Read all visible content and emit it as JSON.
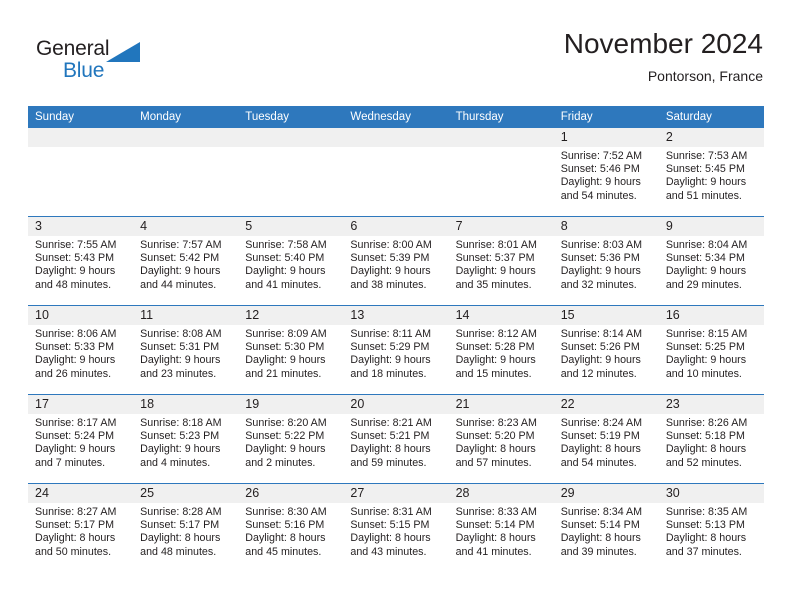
{
  "brand": {
    "name_part1": "General",
    "name_part2": "Blue",
    "triangle_icon": "triangle-icon",
    "colors": {
      "dark": "#231f20",
      "blue": "#2176bd"
    }
  },
  "header": {
    "month_title": "November 2024",
    "location": "Pontorson, France"
  },
  "theme": {
    "header_blue": "#2e78bd",
    "daynum_band": "#f0f0f0",
    "text": "#231f20"
  },
  "weekday_headers": [
    "Sunday",
    "Monday",
    "Tuesday",
    "Wednesday",
    "Thursday",
    "Friday",
    "Saturday"
  ],
  "weeks": [
    [
      {
        "day": "",
        "empty": true
      },
      {
        "day": "",
        "empty": true
      },
      {
        "day": "",
        "empty": true
      },
      {
        "day": "",
        "empty": true
      },
      {
        "day": "",
        "empty": true
      },
      {
        "day": "1",
        "sunrise": "Sunrise: 7:52 AM",
        "sunset": "Sunset: 5:46 PM",
        "daylight1": "Daylight: 9 hours",
        "daylight2": "and 54 minutes."
      },
      {
        "day": "2",
        "sunrise": "Sunrise: 7:53 AM",
        "sunset": "Sunset: 5:45 PM",
        "daylight1": "Daylight: 9 hours",
        "daylight2": "and 51 minutes."
      }
    ],
    [
      {
        "day": "3",
        "sunrise": "Sunrise: 7:55 AM",
        "sunset": "Sunset: 5:43 PM",
        "daylight1": "Daylight: 9 hours",
        "daylight2": "and 48 minutes."
      },
      {
        "day": "4",
        "sunrise": "Sunrise: 7:57 AM",
        "sunset": "Sunset: 5:42 PM",
        "daylight1": "Daylight: 9 hours",
        "daylight2": "and 44 minutes."
      },
      {
        "day": "5",
        "sunrise": "Sunrise: 7:58 AM",
        "sunset": "Sunset: 5:40 PM",
        "daylight1": "Daylight: 9 hours",
        "daylight2": "and 41 minutes."
      },
      {
        "day": "6",
        "sunrise": "Sunrise: 8:00 AM",
        "sunset": "Sunset: 5:39 PM",
        "daylight1": "Daylight: 9 hours",
        "daylight2": "and 38 minutes."
      },
      {
        "day": "7",
        "sunrise": "Sunrise: 8:01 AM",
        "sunset": "Sunset: 5:37 PM",
        "daylight1": "Daylight: 9 hours",
        "daylight2": "and 35 minutes."
      },
      {
        "day": "8",
        "sunrise": "Sunrise: 8:03 AM",
        "sunset": "Sunset: 5:36 PM",
        "daylight1": "Daylight: 9 hours",
        "daylight2": "and 32 minutes."
      },
      {
        "day": "9",
        "sunrise": "Sunrise: 8:04 AM",
        "sunset": "Sunset: 5:34 PM",
        "daylight1": "Daylight: 9 hours",
        "daylight2": "and 29 minutes."
      }
    ],
    [
      {
        "day": "10",
        "sunrise": "Sunrise: 8:06 AM",
        "sunset": "Sunset: 5:33 PM",
        "daylight1": "Daylight: 9 hours",
        "daylight2": "and 26 minutes."
      },
      {
        "day": "11",
        "sunrise": "Sunrise: 8:08 AM",
        "sunset": "Sunset: 5:31 PM",
        "daylight1": "Daylight: 9 hours",
        "daylight2": "and 23 minutes."
      },
      {
        "day": "12",
        "sunrise": "Sunrise: 8:09 AM",
        "sunset": "Sunset: 5:30 PM",
        "daylight1": "Daylight: 9 hours",
        "daylight2": "and 21 minutes."
      },
      {
        "day": "13",
        "sunrise": "Sunrise: 8:11 AM",
        "sunset": "Sunset: 5:29 PM",
        "daylight1": "Daylight: 9 hours",
        "daylight2": "and 18 minutes."
      },
      {
        "day": "14",
        "sunrise": "Sunrise: 8:12 AM",
        "sunset": "Sunset: 5:28 PM",
        "daylight1": "Daylight: 9 hours",
        "daylight2": "and 15 minutes."
      },
      {
        "day": "15",
        "sunrise": "Sunrise: 8:14 AM",
        "sunset": "Sunset: 5:26 PM",
        "daylight1": "Daylight: 9 hours",
        "daylight2": "and 12 minutes."
      },
      {
        "day": "16",
        "sunrise": "Sunrise: 8:15 AM",
        "sunset": "Sunset: 5:25 PM",
        "daylight1": "Daylight: 9 hours",
        "daylight2": "and 10 minutes."
      }
    ],
    [
      {
        "day": "17",
        "sunrise": "Sunrise: 8:17 AM",
        "sunset": "Sunset: 5:24 PM",
        "daylight1": "Daylight: 9 hours",
        "daylight2": "and 7 minutes."
      },
      {
        "day": "18",
        "sunrise": "Sunrise: 8:18 AM",
        "sunset": "Sunset: 5:23 PM",
        "daylight1": "Daylight: 9 hours",
        "daylight2": "and 4 minutes."
      },
      {
        "day": "19",
        "sunrise": "Sunrise: 8:20 AM",
        "sunset": "Sunset: 5:22 PM",
        "daylight1": "Daylight: 9 hours",
        "daylight2": "and 2 minutes."
      },
      {
        "day": "20",
        "sunrise": "Sunrise: 8:21 AM",
        "sunset": "Sunset: 5:21 PM",
        "daylight1": "Daylight: 8 hours",
        "daylight2": "and 59 minutes."
      },
      {
        "day": "21",
        "sunrise": "Sunrise: 8:23 AM",
        "sunset": "Sunset: 5:20 PM",
        "daylight1": "Daylight: 8 hours",
        "daylight2": "and 57 minutes."
      },
      {
        "day": "22",
        "sunrise": "Sunrise: 8:24 AM",
        "sunset": "Sunset: 5:19 PM",
        "daylight1": "Daylight: 8 hours",
        "daylight2": "and 54 minutes."
      },
      {
        "day": "23",
        "sunrise": "Sunrise: 8:26 AM",
        "sunset": "Sunset: 5:18 PM",
        "daylight1": "Daylight: 8 hours",
        "daylight2": "and 52 minutes."
      }
    ],
    [
      {
        "day": "24",
        "sunrise": "Sunrise: 8:27 AM",
        "sunset": "Sunset: 5:17 PM",
        "daylight1": "Daylight: 8 hours",
        "daylight2": "and 50 minutes."
      },
      {
        "day": "25",
        "sunrise": "Sunrise: 8:28 AM",
        "sunset": "Sunset: 5:17 PM",
        "daylight1": "Daylight: 8 hours",
        "daylight2": "and 48 minutes."
      },
      {
        "day": "26",
        "sunrise": "Sunrise: 8:30 AM",
        "sunset": "Sunset: 5:16 PM",
        "daylight1": "Daylight: 8 hours",
        "daylight2": "and 45 minutes."
      },
      {
        "day": "27",
        "sunrise": "Sunrise: 8:31 AM",
        "sunset": "Sunset: 5:15 PM",
        "daylight1": "Daylight: 8 hours",
        "daylight2": "and 43 minutes."
      },
      {
        "day": "28",
        "sunrise": "Sunrise: 8:33 AM",
        "sunset": "Sunset: 5:14 PM",
        "daylight1": "Daylight: 8 hours",
        "daylight2": "and 41 minutes."
      },
      {
        "day": "29",
        "sunrise": "Sunrise: 8:34 AM",
        "sunset": "Sunset: 5:14 PM",
        "daylight1": "Daylight: 8 hours",
        "daylight2": "and 39 minutes."
      },
      {
        "day": "30",
        "sunrise": "Sunrise: 8:35 AM",
        "sunset": "Sunset: 5:13 PM",
        "daylight1": "Daylight: 8 hours",
        "daylight2": "and 37 minutes."
      }
    ]
  ]
}
